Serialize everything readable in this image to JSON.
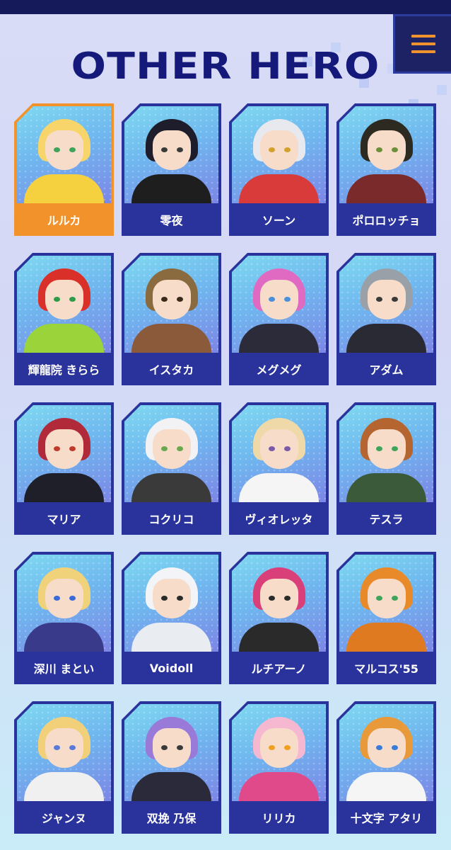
{
  "header": {
    "title": "OTHER HERO",
    "menu_icon": "hamburger-menu-icon"
  },
  "colors": {
    "navy": "#2a339b",
    "title": "#15197a",
    "accent": "#f2922a",
    "menu": "#1c2264"
  },
  "heroes": [
    {
      "name": "ルルカ",
      "active": true,
      "hair": "#f7d56a",
      "eyes": "#3fa35a",
      "outfit": "#f5d03f"
    },
    {
      "name": "零夜",
      "active": false,
      "hair": "#1d1d2b",
      "eyes": "#3a3a3a",
      "outfit": "#1e1e1e"
    },
    {
      "name": "ソーン",
      "active": false,
      "hair": "#e8e9ee",
      "eyes": "#d1a12b",
      "outfit": "#d93a3a"
    },
    {
      "name": "ポロロッチョ",
      "active": false,
      "hair": "#2d2a22",
      "eyes": "#6b8f3a",
      "outfit": "#7a2a2a"
    },
    {
      "name": "輝龍院 きらら",
      "active": false,
      "hair": "#d9302a",
      "eyes": "#2f9a4a",
      "outfit": "#9bd33a"
    },
    {
      "name": "イスタカ",
      "active": false,
      "hair": "#8a6a3f",
      "eyes": "#3a2a1a",
      "outfit": "#8b5a3a"
    },
    {
      "name": "メグメグ",
      "active": false,
      "hair": "#e06ac2",
      "eyes": "#4a8fd9",
      "outfit": "#2b2b3a"
    },
    {
      "name": "アダム",
      "active": false,
      "hair": "#9aa0a8",
      "eyes": "#3a3a3a",
      "outfit": "#2a2a35"
    },
    {
      "name": "マリア",
      "active": false,
      "hair": "#b02a3a",
      "eyes": "#c0392b",
      "outfit": "#1f1f29"
    },
    {
      "name": "コクリコ",
      "active": false,
      "hair": "#f2f2f5",
      "eyes": "#6aa84f",
      "outfit": "#3a3a3a"
    },
    {
      "name": "ヴィオレッタ",
      "active": false,
      "hair": "#f0d9a8",
      "eyes": "#7a5aa8",
      "outfit": "#f5f5f5"
    },
    {
      "name": "テスラ",
      "active": false,
      "hair": "#b5652f",
      "eyes": "#3fa35a",
      "outfit": "#3a5a3a"
    },
    {
      "name": "深川 まとい",
      "active": false,
      "hair": "#f0d27a",
      "eyes": "#3a6ad9",
      "outfit": "#3a3a8a"
    },
    {
      "name": "Voidoll",
      "active": false,
      "hair": "#f2f4f7",
      "eyes": "#2a2a2a",
      "outfit": "#e9ecf0"
    },
    {
      "name": "ルチアーノ",
      "active": false,
      "hair": "#d9407a",
      "eyes": "#2a2a2a",
      "outfit": "#2a2a2a"
    },
    {
      "name": "マルコス'55",
      "active": false,
      "hair": "#e88a2a",
      "eyes": "#3fa35a",
      "outfit": "#e07a20"
    },
    {
      "name": "ジャンヌ",
      "active": false,
      "hair": "#f2d07a",
      "eyes": "#5a7ad9",
      "outfit": "#f0f0f0"
    },
    {
      "name": "双挽 乃保",
      "active": false,
      "hair": "#9a7ad9",
      "eyes": "#3a3a3a",
      "outfit": "#2a2a3a"
    },
    {
      "name": "リリカ",
      "active": false,
      "hair": "#f5b8d0",
      "eyes": "#f0a020",
      "outfit": "#e04a8a"
    },
    {
      "name": "十文字 アタリ",
      "active": false,
      "hair": "#e89a3a",
      "eyes": "#3a7ad9",
      "outfit": "#f5f5f5"
    }
  ]
}
